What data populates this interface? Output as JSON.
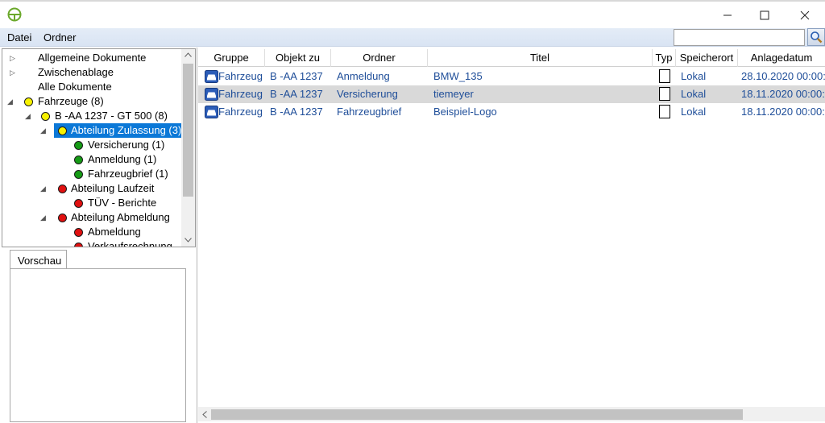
{
  "window": {
    "minimize": "–",
    "maximize": "□",
    "close": "✕"
  },
  "menu": {
    "items": [
      "Datei",
      "Ordner"
    ]
  },
  "search": {
    "value": "",
    "placeholder": ""
  },
  "tree": {
    "items": [
      {
        "label": "Allgemeine Dokumente",
        "expander": "▷",
        "dot": null
      },
      {
        "label": "Zwischenablage",
        "expander": "▷",
        "dot": null
      },
      {
        "label": "Alle Dokumente",
        "expander": "",
        "dot": null
      },
      {
        "label": "Fahrzeuge (8)",
        "expander": "◢",
        "dot": "yellow"
      },
      {
        "label": "B  -AA 1237 - GT 500 (8)",
        "expander": "◢",
        "dot": "yellow"
      },
      {
        "label": "Abteilung Zulassung (3)",
        "expander": "◢",
        "dot": "yellow",
        "selected": true
      },
      {
        "label": "Versicherung (1)",
        "expander": "",
        "dot": "green"
      },
      {
        "label": "Anmeldung (1)",
        "expander": "",
        "dot": "green"
      },
      {
        "label": "Fahrzeugbrief (1)",
        "expander": "",
        "dot": "green"
      },
      {
        "label": "Abteilung Laufzeit",
        "expander": "◢",
        "dot": "red"
      },
      {
        "label": "TÜV - Berichte",
        "expander": "",
        "dot": "red"
      },
      {
        "label": "Abteilung Abmeldung",
        "expander": "◢",
        "dot": "red"
      },
      {
        "label": "Abmeldung",
        "expander": "",
        "dot": "red"
      },
      {
        "label": "Verkaufsrechnung",
        "expander": "",
        "dot": "red"
      }
    ]
  },
  "preview": {
    "tab_label": "Vorschau"
  },
  "grid": {
    "columns": [
      "Gruppe",
      "Objekt zu",
      "Ordner",
      "Titel",
      "Typ",
      "Speicherort",
      "Anlagedatum"
    ],
    "rows": [
      {
        "gruppe": "Fahrzeug",
        "objekt": "B  -AA 1237",
        "ordner": "Anmeldung",
        "titel": "BMW_135",
        "speicherort": "Lokal",
        "datum": "28.10.2020 00:00:"
      },
      {
        "gruppe": "Fahrzeug",
        "objekt": "B  -AA 1237",
        "ordner": "Versicherung",
        "titel": "tiemeyer",
        "speicherort": "Lokal",
        "datum": "18.11.2020 00:00:"
      },
      {
        "gruppe": "Fahrzeug",
        "objekt": "B  -AA 1237",
        "ordner": "Fahrzeugbrief",
        "titel": "Beispiel-Logo",
        "speicherort": "Lokal",
        "datum": "18.11.2020 00:00:"
      }
    ]
  },
  "colors": {
    "accent": "#0b78d7",
    "link_text": "#1f4e99",
    "selected_row": "#d9d9d9",
    "status_yellow": "#f7f200",
    "status_green": "#169b16",
    "status_red": "#e01010"
  }
}
